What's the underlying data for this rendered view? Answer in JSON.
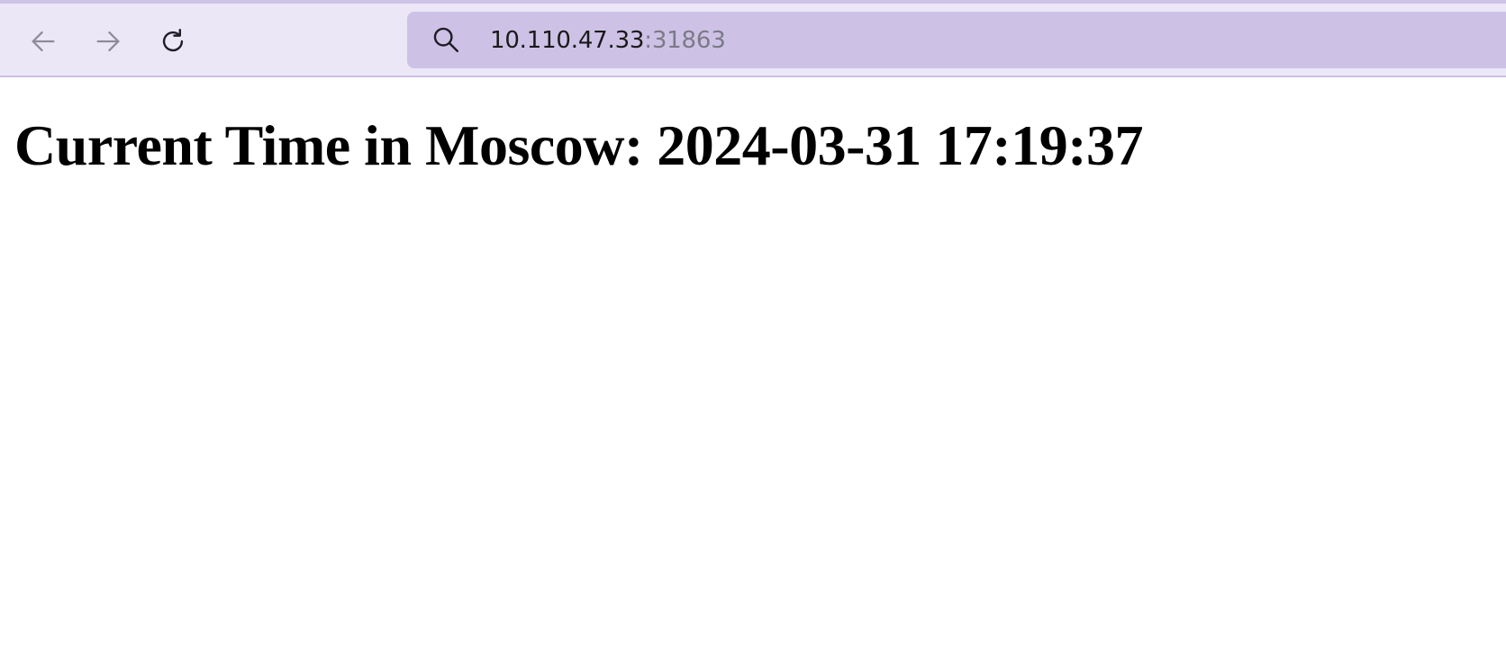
{
  "browser": {
    "url_host": "10.110.47.33",
    "url_port": ":31863",
    "chrome_color": "#ece7f7",
    "urlbar_color": "#cdc2e6",
    "icons": {
      "back": "arrow-left-icon",
      "forward": "arrow-right-icon",
      "reload": "reload-icon",
      "search": "search-icon"
    }
  },
  "page": {
    "heading": "Current Time in Moscow: 2024-03-31 17:19:37"
  }
}
